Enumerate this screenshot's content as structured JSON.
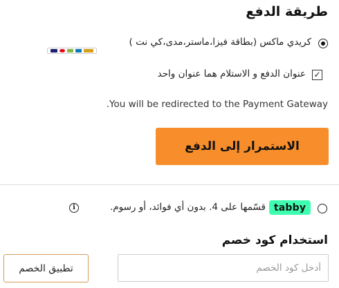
{
  "payment": {
    "title": "طريقة الدفع",
    "option_label": "كريدي ماكس (بطاقة فيزا،ماستر،مدى،كي نت )",
    "card_icons": [
      {
        "name": "visa-icon",
        "color": "#1a1f71"
      },
      {
        "name": "mastercard-icon",
        "color": "#eb001b"
      },
      {
        "name": "mada-icon",
        "color": "#84b740"
      },
      {
        "name": "knet-icon",
        "color": "#0a7ab8"
      },
      {
        "name": "benefit-icon",
        "color": "#d4a017"
      }
    ],
    "same_address_label": "عنوان الدفع و الاستلام هما عنوان واحد",
    "same_address_checked": true,
    "redirect_note": "You will be redirected to the Payment Gateway.",
    "continue_button": "الاستمرار إلى الدفع"
  },
  "tabby": {
    "logo_text": "tabby",
    "text": "قسّمها على 4. بدون أي فوائد، أو رسوم.",
    "info_icon": "i"
  },
  "coupon": {
    "title": "استخدام كود خصم",
    "placeholder": "أدخل كود الخصم",
    "value": "",
    "apply_button": "تطبيق الخصم"
  },
  "colors": {
    "accent": "#f78d2b",
    "tabby_green": "#3dffaf"
  }
}
